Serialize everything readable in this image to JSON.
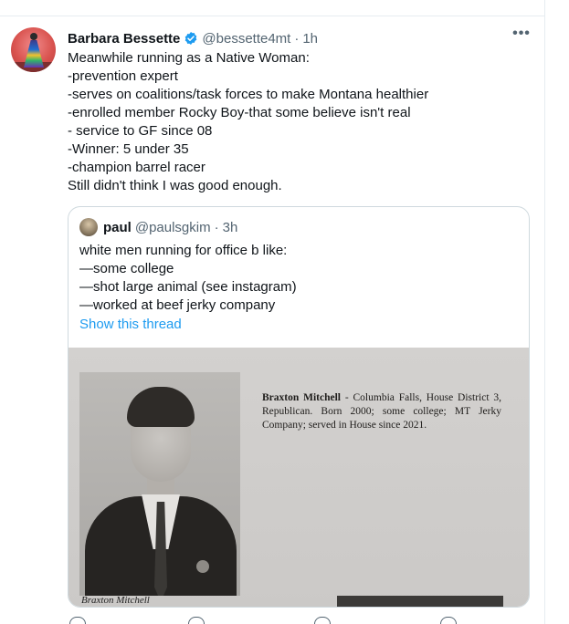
{
  "tweet": {
    "author_name": "Barbara Bessette",
    "handle": "@bessette4mt",
    "separator": "·",
    "time": "1h",
    "verified": true,
    "lines": [
      "Meanwhile running as a Native Woman:",
      "-prevention expert",
      "-serves on coalitions/task forces to make Montana healthier",
      "-enrolled member Rocky Boy-that some believe isn't real",
      "- service to GF since 08",
      "-Winner: 5 under 35",
      "-champion barrel racer",
      "Still didn't think I was good enough."
    ],
    "more_icon": "more-horizontal-icon"
  },
  "quoted_tweet": {
    "author_name": "paul",
    "handle": "@paulsgkim",
    "separator": "·",
    "time": "3h",
    "lines": [
      "white men running for office b like:",
      "—some college",
      "—shot large animal (see instagram)",
      "—worked at beef jerky company"
    ],
    "show_thread": "Show this thread",
    "photo": {
      "caption_name": "Braxton Mitchell",
      "caption_rest": " - Columbia Falls, House District 3, Republican. Born 2000; some college; MT Jerky Company; served in House since 2021.",
      "portrait_label": "Braxton Mitchell"
    }
  },
  "colors": {
    "text": "#0f1419",
    "secondary": "#536471",
    "link": "#1d9bf0",
    "border": "#cfd9de",
    "verified": "#1d9bf0"
  }
}
